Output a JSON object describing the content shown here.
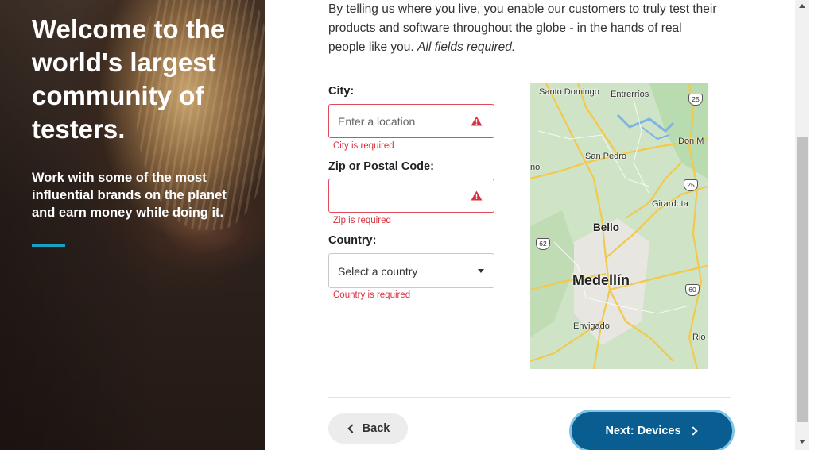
{
  "hero": {
    "title": "Welcome to the world's largest community of testers.",
    "subtitle": "Work with some of the most influential brands on the planet and earn money while doing it."
  },
  "intro": {
    "text": "By telling us where you live, you enable our customers to truly test their products and software throughout the globe - in the hands of real people like you. ",
    "required_note": "All fields required."
  },
  "form": {
    "city": {
      "label": "City:",
      "placeholder": "Enter a location",
      "error": "City is required"
    },
    "zip": {
      "label": "Zip or Postal Code:",
      "value": "",
      "error": "Zip is required"
    },
    "country": {
      "label": "Country:",
      "selected": "Select a country",
      "error": "Country is required"
    }
  },
  "map": {
    "places": [
      "Santo Domingo",
      "Entrerríos",
      "Don M",
      "San Pedro",
      "no",
      "Girardota",
      "Bello",
      "Medellín",
      "Envigado",
      "Rio"
    ],
    "route_shields": [
      "25",
      "25",
      "62",
      "60"
    ]
  },
  "buttons": {
    "back": "Back",
    "next": "Next: Devices"
  },
  "colors": {
    "accent": "#1aa0c4",
    "primary_button": "#0a5d90",
    "error": "#d7313f"
  }
}
